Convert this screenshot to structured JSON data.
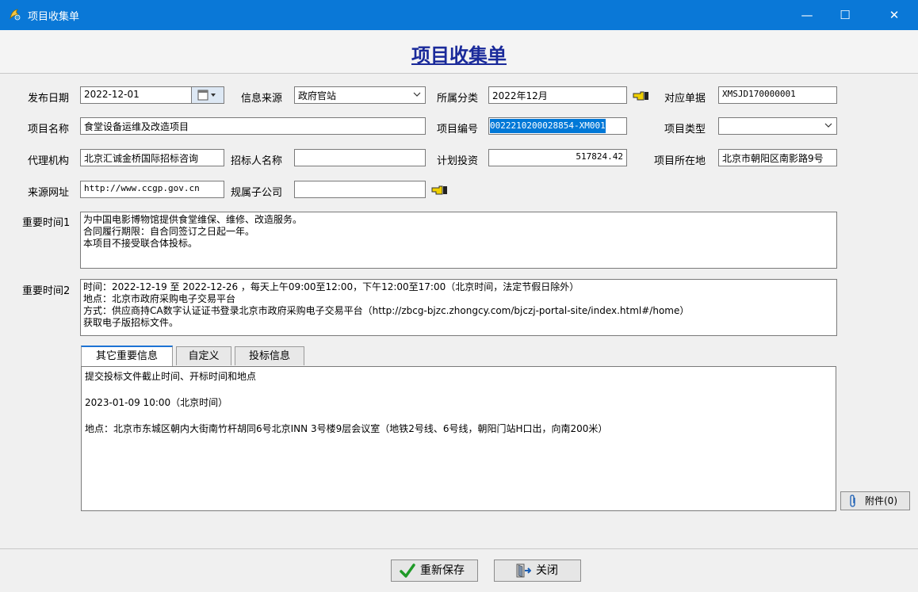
{
  "window": {
    "title": "项目收集单",
    "min": "—",
    "max": "☐",
    "close": "✕"
  },
  "header": {
    "title": "项目收集单"
  },
  "form": {
    "publish_date_label": "发布日期",
    "publish_date": "2022-12-01",
    "source_label": "信息来源",
    "source": "政府官站",
    "category_label": "所属分类",
    "category": "2022年12月",
    "doc_label": "对应单据",
    "doc": "XMSJD170000001",
    "name_label": "项目名称",
    "name": "食堂设备运维及改造项目",
    "code_label": "项目编号",
    "code": "0022210200028854-XM001",
    "type_label": "项目类型",
    "type": "",
    "agency_label": "代理机构",
    "agency": "北京汇诚金桥国际招标咨询",
    "tenderer_label": "招标人名称",
    "tenderer": "",
    "investment_label": "计划投资",
    "investment": "517824.42",
    "location_label": "项目所在地",
    "location": "北京市朝阳区南影路9号",
    "url_label": "来源网址",
    "url": "http://www.ccgp.gov.cn",
    "subsidiary_label": "规属子公司",
    "subsidiary": "",
    "time1_label": "重要时间1",
    "time1": "为中国电影博物馆提供食堂维保、维修、改造服务。\n合同履行期限：自合同签订之日起一年。\n本项目不接受联合体投标。",
    "time2_label": "重要时间2",
    "time2": "时间：2022-12-19 至 2022-12-26 ，每天上午09:00至12:00，下午12:00至17:00（北京时间，法定节假日除外）\n地点：北京市政府采购电子交易平台\n方式：供应商持CA数字认证证书登录北京市政府采购电子交易平台（http://zbcg-bjzc.zhongcy.com/bjczj-portal-site/index.html#/home）\n获取电子版招标文件。"
  },
  "tabs": [
    {
      "label": "其它重要信息"
    },
    {
      "label": "自定义"
    },
    {
      "label": "投标信息"
    }
  ],
  "tab_content": {
    "line1": "提交投标文件截止时间、开标时间和地点",
    "line2": "2023-01-09 10:00（北京时间）",
    "line3": "地点：北京市东城区朝内大街南竹杆胡同6号北京INN 3号楼9层会议室（地铁2号线、6号线，朝阳门站H口出，向南200米）"
  },
  "attachment": {
    "label": "附件(0)"
  },
  "footer": {
    "save_label": "重新保存",
    "close_label": "关闭"
  },
  "colors": {
    "titlebar": "#0a78d7",
    "header_title": "#1a2a9a",
    "selection": "#0078d7"
  }
}
